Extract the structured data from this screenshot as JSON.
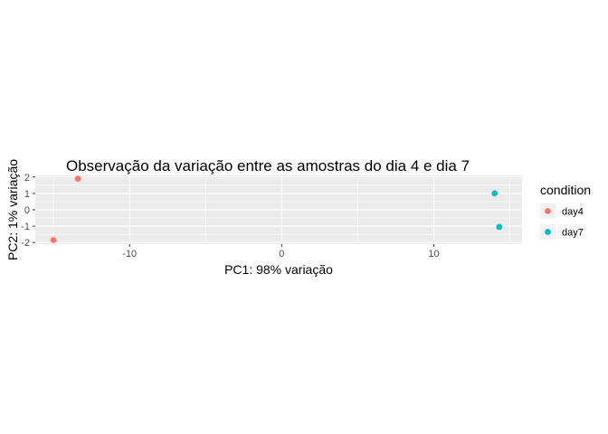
{
  "chart_data": {
    "type": "scatter",
    "title": "Observação da variação entre as amostras do dia 4 e dia 7",
    "xlabel": "PC1: 98% variação",
    "ylabel": "PC2: 1% variação",
    "xlim": [
      -16.2,
      15.8
    ],
    "ylim": [
      -2.1,
      2.1
    ],
    "x_ticks": [
      -10,
      0,
      10
    ],
    "x_tick_labels": [
      "-10",
      "0",
      "10"
    ],
    "y_ticks": [
      -2,
      -1,
      0,
      1,
      2
    ],
    "y_tick_labels": [
      "-2",
      "-1",
      "0",
      "1",
      "2"
    ],
    "grid": true,
    "legend": {
      "title": "condition",
      "position": "right",
      "entries": [
        {
          "label": "day4",
          "color": "#F8766D"
        },
        {
          "label": "day7",
          "color": "#00BFC4"
        }
      ]
    },
    "series": [
      {
        "name": "day4",
        "color": "#F8766D",
        "points": [
          [
            -13.4,
            1.9
          ],
          [
            -15.0,
            -1.85
          ]
        ]
      },
      {
        "name": "day7",
        "color": "#00BFC4",
        "points": [
          [
            14.0,
            1.0
          ],
          [
            14.3,
            -1.05
          ]
        ]
      }
    ]
  }
}
